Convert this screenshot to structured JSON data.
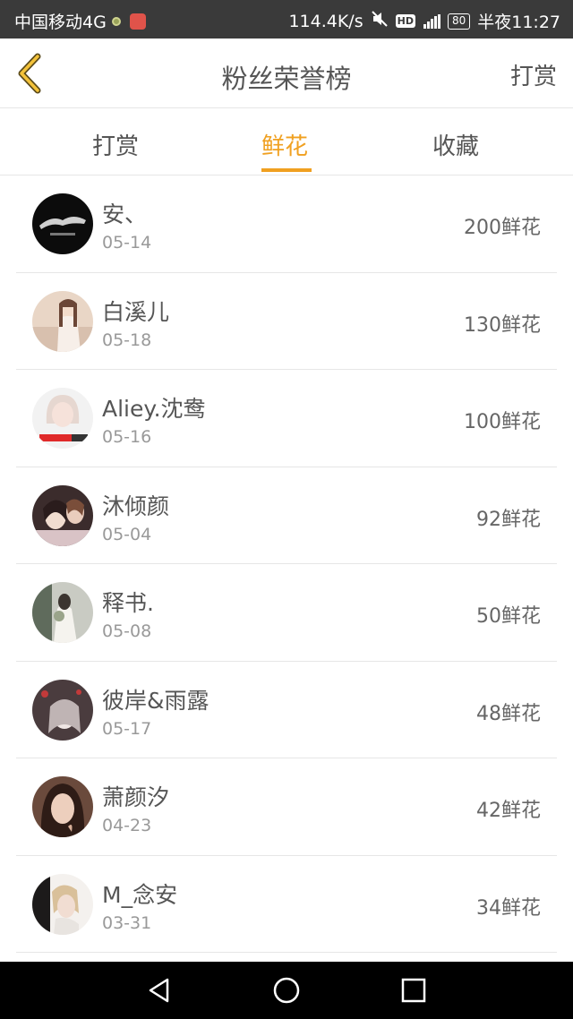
{
  "status_bar": {
    "carrier": "中国移动4G",
    "speed": "114.4K/s",
    "hd": "HD",
    "battery": "80",
    "time": "半夜11:27"
  },
  "header": {
    "title": "粉丝荣誉榜",
    "action_label": "打赏",
    "back_icon": "chevron-left-icon",
    "accent_color": "#f0a020"
  },
  "tabs": [
    {
      "label": "打赏",
      "active": false
    },
    {
      "label": "鲜花",
      "active": true
    },
    {
      "label": "收藏",
      "active": false
    }
  ],
  "fans": [
    {
      "name": "安、",
      "date": "05-14",
      "amount": "200鲜花"
    },
    {
      "name": "白溪儿",
      "date": "05-18",
      "amount": "130鲜花"
    },
    {
      "name": "Aliey.沈鸯",
      "date": "05-16",
      "amount": "100鲜花"
    },
    {
      "name": "沐倾颜",
      "date": "05-04",
      "amount": "92鲜花"
    },
    {
      "name": "释书.",
      "date": "05-08",
      "amount": "50鲜花"
    },
    {
      "name": "彼岸&雨露",
      "date": "05-17",
      "amount": "48鲜花"
    },
    {
      "name": "萧颜汐",
      "date": "04-23",
      "amount": "42鲜花"
    },
    {
      "name": "M_念安",
      "date": "03-31",
      "amount": "34鲜花"
    }
  ],
  "nav_bar": {
    "icons": [
      "back-triangle-icon",
      "home-circle-icon",
      "recents-square-icon"
    ]
  }
}
